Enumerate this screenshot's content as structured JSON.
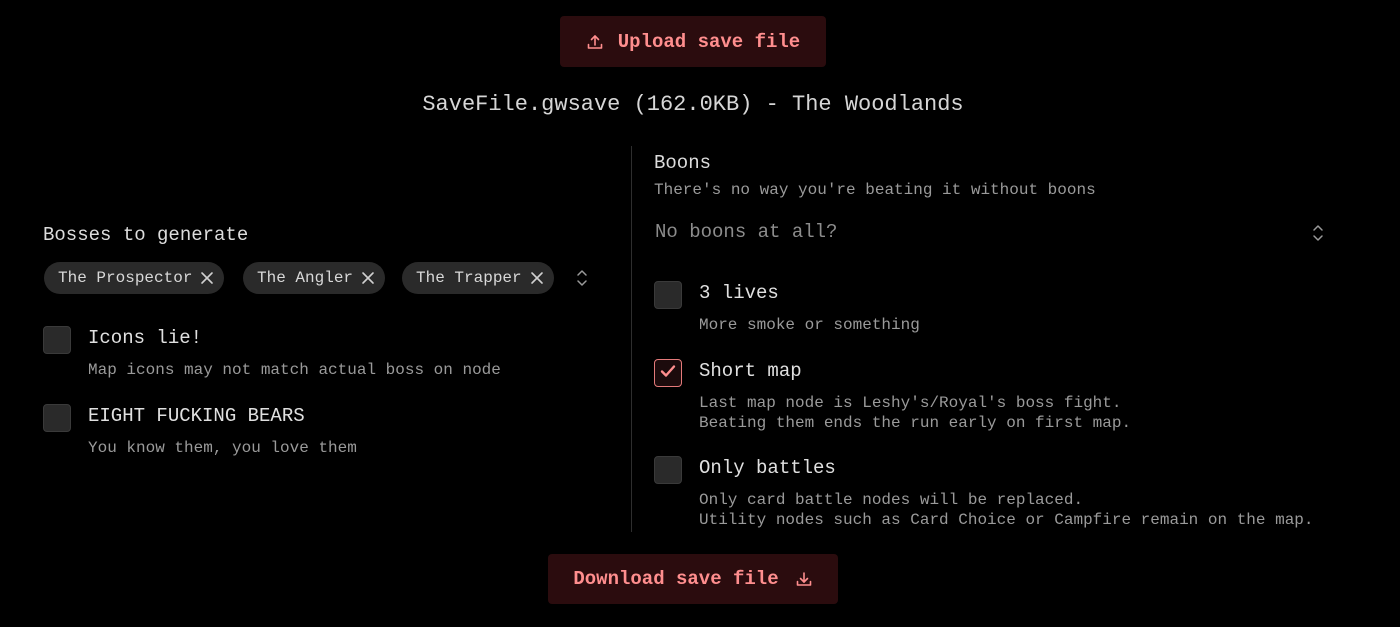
{
  "upload_button": {
    "label": "Upload save file",
    "icon": "upload-icon"
  },
  "file_info": {
    "text": "SaveFile.gwsave (162.0KB) - The Woodlands"
  },
  "bosses": {
    "label": "Bosses to generate",
    "selected": [
      "The Prospector",
      "The Angler",
      "The Trapper"
    ]
  },
  "left_options": [
    {
      "label": "Icons lie!",
      "description": "Map icons may not match actual boss on node",
      "checked": false
    },
    {
      "label": "EIGHT FUCKING BEARS",
      "description": "You know them, you love them",
      "checked": false
    }
  ],
  "boons": {
    "label": "Boons",
    "subtitle": "There's no way you're beating it without boons",
    "placeholder": "No boons at all?"
  },
  "right_options": [
    {
      "label": "3 lives",
      "description_lines": [
        "More smoke or something"
      ],
      "checked": false
    },
    {
      "label": "Short map",
      "description_lines": [
        "Last map node is Leshy's/Royal's boss fight.",
        "Beating them ends the run early on first map."
      ],
      "checked": true
    },
    {
      "label": "Only battles",
      "description_lines": [
        "Only card battle nodes will be replaced.",
        "Utility nodes such as Card Choice or Campfire remain on the map."
      ],
      "checked": false
    }
  ],
  "download_button": {
    "label": "Download save file",
    "icon": "download-icon"
  },
  "colors": {
    "accent": "#ff8e8e",
    "button_bg": "#2b0c0e",
    "background": "#000000"
  }
}
